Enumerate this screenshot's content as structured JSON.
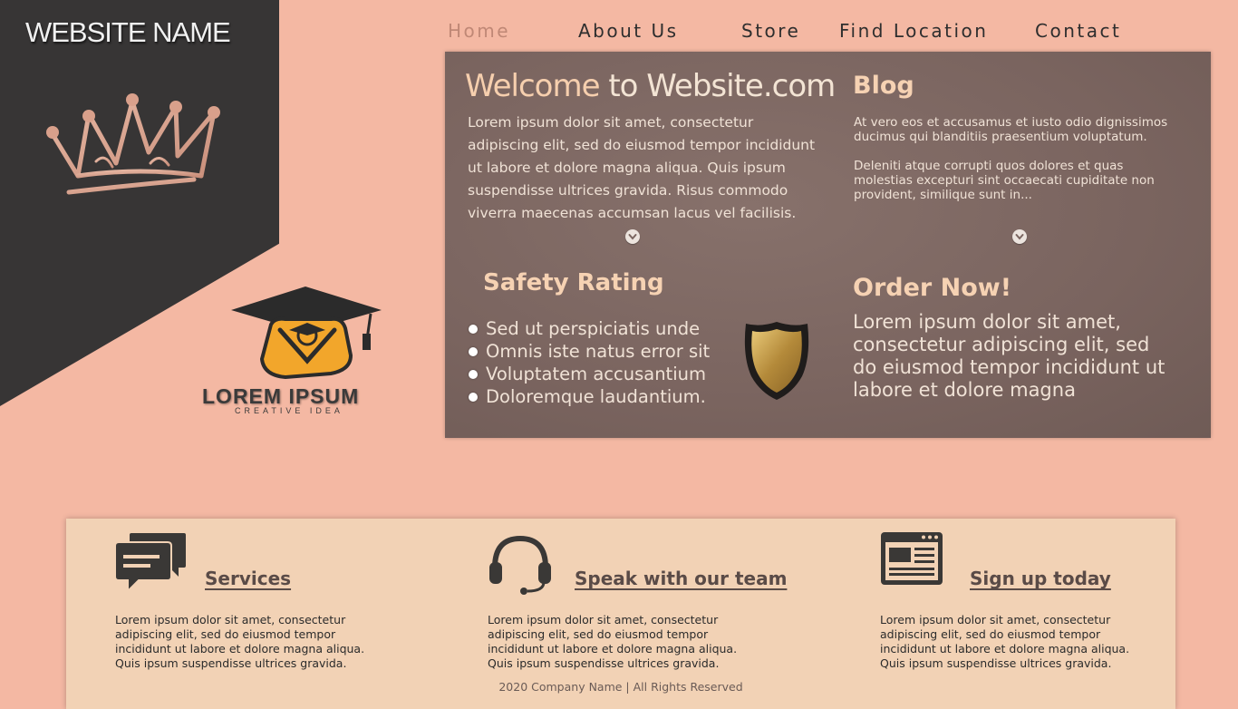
{
  "brand": {
    "site_name": "WEBSITE NAME",
    "logo_text": "LOREM IPSUM",
    "logo_subtext": "CREATIVE IDEA"
  },
  "nav": {
    "items": [
      {
        "label": "Home",
        "active": true
      },
      {
        "label": "About Us",
        "active": false
      },
      {
        "label": "Store",
        "active": false
      },
      {
        "label": "Find Location",
        "active": false
      },
      {
        "label": "Contact",
        "active": false
      }
    ]
  },
  "welcome": {
    "title_part1": "Welcome",
    "title_part2": " to Website.com",
    "text": "Lorem ipsum dolor sit amet, consectetur adipiscing elit, sed do eiusmod tempor incididunt ut labore et dolore magna aliqua. Quis ipsum suspendisse ultrices gravida. Risus commodo viverra maecenas accumsan lacus vel facilisis."
  },
  "blog": {
    "title": "Blog",
    "paragraphs": [
      "At vero eos et accusamus et iusto odio dignissimos ducimus qui blanditiis praesentium voluptatum.",
      "Deleniti atque corrupti quos dolores et quas molestias excepturi sint occaecati cupiditate non provident, similique sunt in..."
    ]
  },
  "safety": {
    "title": "Safety Rating",
    "items": [
      "Sed ut perspiciatis unde",
      "Omnis iste natus error sit",
      "Voluptatem accusantium",
      "Doloremque laudantium."
    ]
  },
  "order": {
    "title": "Order Now!",
    "text": "Lorem ipsum dolor sit amet, consectetur adipiscing elit, sed do eiusmod tempor incididunt ut labore et dolore magna"
  },
  "features": [
    {
      "title": "Services",
      "icon": "chat-bubbles-icon",
      "text": "Lorem ipsum dolor sit amet, consectetur adipiscing elit, sed do eiusmod tempor incididunt ut labore et dolore magna aliqua. Quis ipsum suspendisse ultrices gravida."
    },
    {
      "title": "Speak with our team",
      "icon": "headset-icon",
      "text": "Lorem ipsum dolor sit amet, consectetur adipiscing elit, sed do eiusmod tempor incididunt ut labore et dolore magna aliqua. Quis ipsum suspendisse ultrices gravida."
    },
    {
      "title": "Sign up today",
      "icon": "browser-window-icon",
      "text": "Lorem ipsum dolor sit amet, consectetur adipiscing elit, sed do eiusmod tempor incididunt ut labore et dolore magna aliqua. Quis ipsum suspendisse ultrices gravida."
    }
  ],
  "footer": {
    "text": "2020 Company Name | All Rights Reserved"
  },
  "colors": {
    "background": "#f4b8a3",
    "side_panel": "#373535",
    "main_card": "#7a6560",
    "bottom_card": "#f2d2b5",
    "heading_accent": "#f6d2b3",
    "nav_active": "#c08876"
  }
}
